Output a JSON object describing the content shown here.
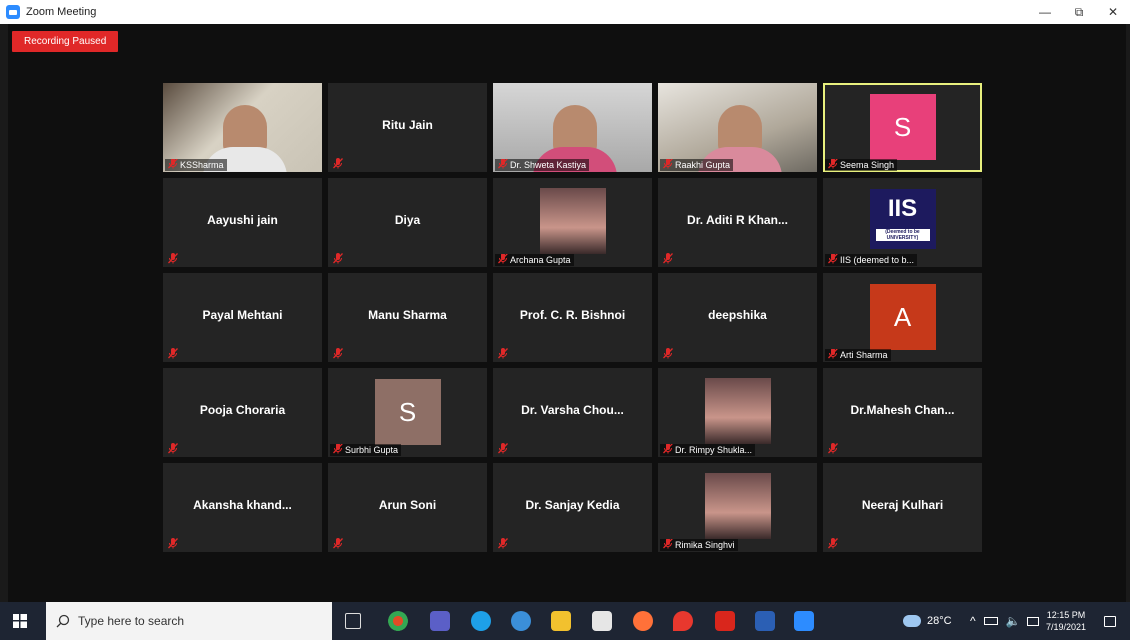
{
  "window": {
    "title": "Zoom Meeting",
    "minimize": "—",
    "restore": "⧉",
    "close": "✕"
  },
  "recording": {
    "label": "Recording Paused"
  },
  "participants": [
    {
      "name": "KSSharma",
      "style": "video"
    },
    {
      "name": "Ritu Jain",
      "style": "name"
    },
    {
      "name": "Dr. Shweta Kastiya",
      "style": "video"
    },
    {
      "name": "Raakhi Gupta",
      "style": "video"
    },
    {
      "name": "Seema Singh",
      "style": "avatar",
      "letter": "S",
      "color": "#e8407a",
      "active": true
    },
    {
      "name": "Aayushi jain",
      "style": "name"
    },
    {
      "name": "Diya",
      "style": "name"
    },
    {
      "name": "Archana Gupta",
      "style": "photo"
    },
    {
      "name": "Dr. Aditi R Khan...",
      "style": "name"
    },
    {
      "name": "IIS (deemed to b...",
      "style": "logo",
      "logo_text": "IIS",
      "logo_sub": "(Deemed to be UNIVERSITY)"
    },
    {
      "name": "Payal Mehtani",
      "style": "name"
    },
    {
      "name": "Manu Sharma",
      "style": "name"
    },
    {
      "name": "Prof. C. R. Bishnoi",
      "style": "name"
    },
    {
      "name": "deepshika",
      "style": "name"
    },
    {
      "name": "Arti Sharma",
      "style": "avatar",
      "letter": "A",
      "color": "#c6391a"
    },
    {
      "name": "Pooja Choraria",
      "style": "name"
    },
    {
      "name": "Surbhi Gupta",
      "style": "avatar",
      "letter": "S",
      "color": "#8e6f66"
    },
    {
      "name": "Dr. Varsha Chou...",
      "style": "name"
    },
    {
      "name": "Dr. Rimpy Shukla...",
      "style": "photo"
    },
    {
      "name": "Dr.Mahesh Chan...",
      "style": "name"
    },
    {
      "name": "Akansha khand...",
      "style": "name"
    },
    {
      "name": "Arun Soni",
      "style": "name"
    },
    {
      "name": "Dr. Sanjay Kedia",
      "style": "name"
    },
    {
      "name": "Rimika Singhvi",
      "style": "photo"
    },
    {
      "name": "Neeraj Kulhari",
      "style": "name"
    }
  ],
  "taskbar": {
    "search_placeholder": "Type here to search",
    "weather": "28°C",
    "time": "12:15 PM",
    "date": "7/19/2021"
  },
  "colors": {
    "active_outline": "#e8f07e",
    "recording": "#e02828",
    "muted_mic": "#e02828"
  }
}
